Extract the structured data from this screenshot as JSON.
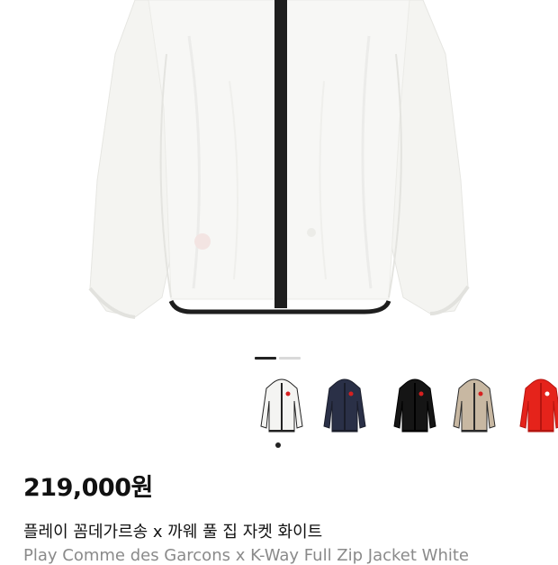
{
  "gallery": {
    "page_count": 2,
    "current_page": 1,
    "hero_alt": "white hooded full-zip jacket",
    "variants": [
      {
        "name": "white-jacket",
        "body_color": "#f4f4f2",
        "trim_color": "#222222",
        "logo_color": "#d62020"
      },
      {
        "name": "navy-jacket",
        "body_color": "#2a3047",
        "trim_color": "#1a1d2a",
        "logo_color": "#d62020"
      },
      {
        "name": "black-jacket",
        "body_color": "#151515",
        "trim_color": "#000000",
        "logo_color": "#d62020"
      },
      {
        "name": "beige-black-jacket",
        "body_color": "#c8b8a2",
        "trim_color": "#2a2a2a",
        "logo_color": "#d62020"
      },
      {
        "name": "red-jacket",
        "body_color": "#e5231b",
        "trim_color": "#b5140f",
        "logo_color": "#ffffff"
      }
    ],
    "selected_variant": 0
  },
  "product": {
    "price": "219,000원",
    "title_ko": "플레이 꼼데가르송 x 까웨 풀 집 자켓 화이트",
    "title_en": "Play Comme des Garcons x K-Way Full Zip Jacket White"
  }
}
